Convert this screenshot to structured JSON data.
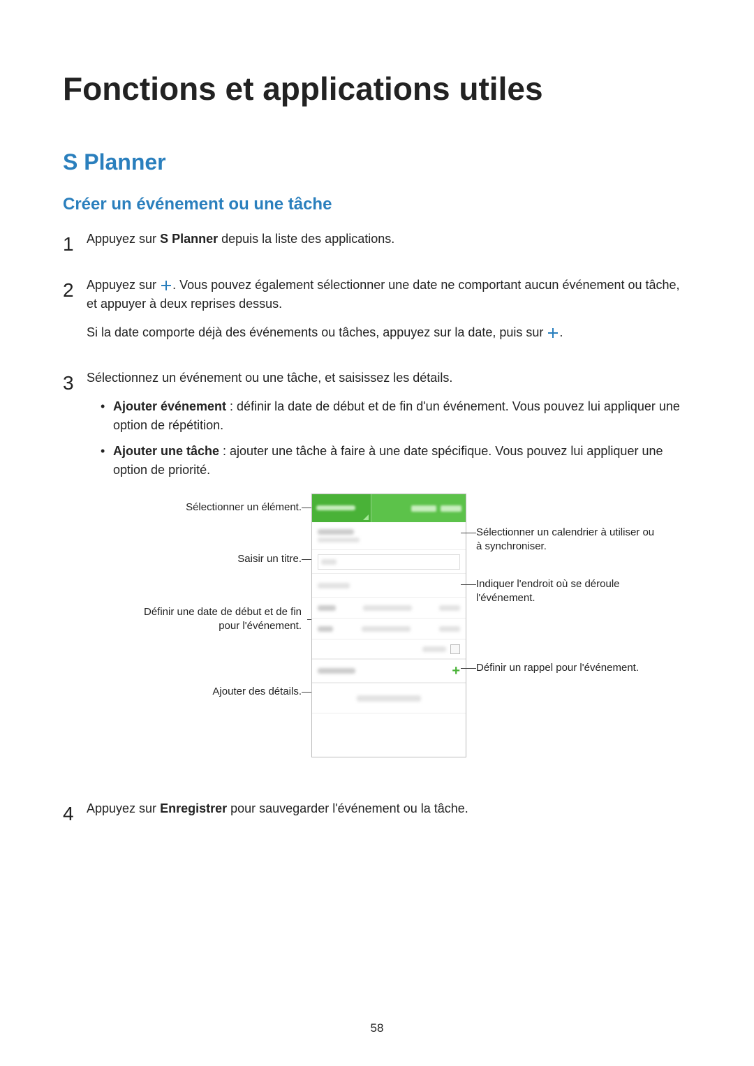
{
  "page": {
    "title": "Fonctions et applications utiles",
    "section": "S Planner",
    "subsection": "Créer un événement ou une tâche",
    "page_number": "58"
  },
  "steps": {
    "s1": {
      "num": "1",
      "pre": "Appuyez sur ",
      "bold": "S Planner",
      "post": " depuis la liste des applications."
    },
    "s2": {
      "num": "2",
      "p1_pre": "Appuyez sur ",
      "p1_post": ". Vous pouvez également sélectionner une date ne comportant aucun événement ou tâche, et appuyer à deux reprises dessus.",
      "p2_pre": "Si la date comporte déjà des événements ou tâches, appuyez sur la date, puis sur ",
      "p2_post": "."
    },
    "s3": {
      "num": "3",
      "intro": "Sélectionnez un événement ou une tâche, et saisissez les détails.",
      "b1_bold": "Ajouter événement",
      "b1_rest": " : définir la date de début et de fin d'un événement. Vous pouvez lui appliquer une option de répétition.",
      "b2_bold": "Ajouter une tâche",
      "b2_rest": " : ajouter une tâche à faire à une date spécifique. Vous pouvez lui appliquer une option de priorité."
    },
    "s4": {
      "num": "4",
      "pre": "Appuyez sur ",
      "bold": "Enregistrer",
      "post": " pour sauvegarder l'événement ou la tâche."
    }
  },
  "callouts": {
    "left1": "Sélectionner un élément.",
    "left2": "Saisir un titre.",
    "left3": "Définir une date de début et de fin pour l'événement.",
    "left4": "Ajouter des détails.",
    "right1": "Sélectionner un calendrier à utiliser ou à synchroniser.",
    "right2": "Indiquer l'endroit où se déroule l'événement.",
    "right3": "Définir un rappel pour l'événement."
  }
}
